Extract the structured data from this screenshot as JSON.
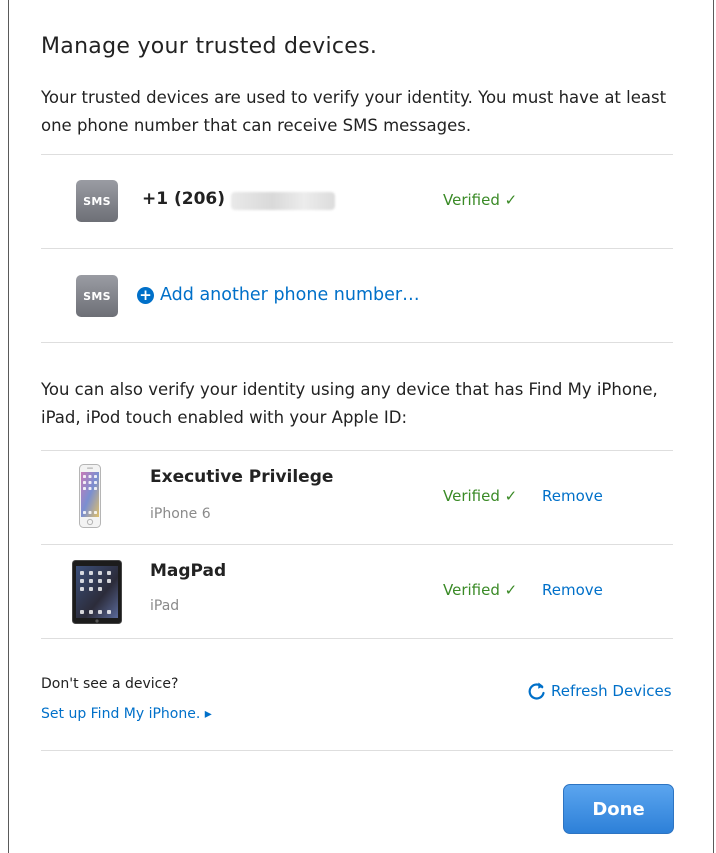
{
  "header": {
    "title": "Manage your trusted devices.",
    "intro": "Your trusted devices are used to verify your identity. You must have at least one phone number that can receive SMS messages."
  },
  "phones": [
    {
      "icon": "sms-icon",
      "icon_label": "SMS",
      "number": "+1 (206)",
      "status": "Verified ✓"
    }
  ],
  "add_phone": {
    "icon": "sms-icon",
    "icon_label": "SMS",
    "plus_icon": "plus-circle-icon",
    "label": "Add another phone number…"
  },
  "find_my": {
    "text": "You can also verify your identity using any device that has Find My iPhone, iPad, iPod touch enabled with your Apple ID:"
  },
  "devices": [
    {
      "icon": "iphone-icon",
      "name": "Executive Privilege",
      "model": "iPhone 6",
      "status": "Verified ✓",
      "remove_label": "Remove"
    },
    {
      "icon": "ipad-icon",
      "name": "MagPad",
      "model": "iPad",
      "status": "Verified ✓",
      "remove_label": "Remove"
    }
  ],
  "footer": {
    "dont_see": "Don't see a device?",
    "setup_link": "Set up Find My iPhone. ▸",
    "refresh_icon": "refresh-icon",
    "refresh_label": "Refresh Devices",
    "done_label": "Done"
  },
  "colors": {
    "link": "#0070c9",
    "verified": "#3a8a26",
    "button": "#2d80d8"
  }
}
